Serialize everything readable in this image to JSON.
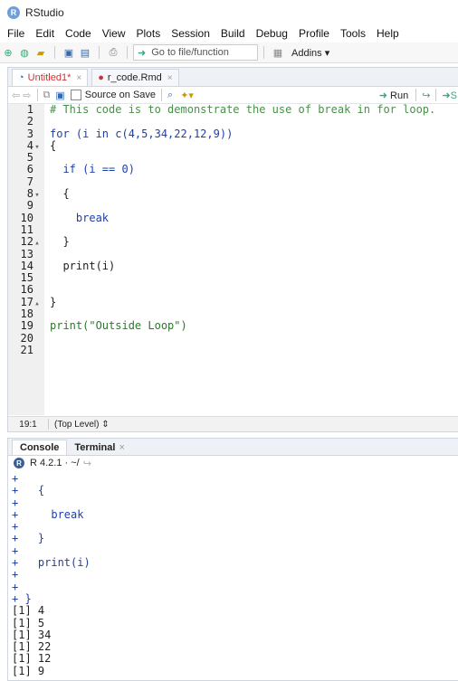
{
  "app": {
    "title": "RStudio",
    "logo": "R"
  },
  "menu": [
    "File",
    "Edit",
    "Code",
    "View",
    "Plots",
    "Session",
    "Build",
    "Debug",
    "Profile",
    "Tools",
    "Help"
  ],
  "toolbar": {
    "goto_placeholder": "Go to file/function",
    "addins_label": "Addins"
  },
  "editor": {
    "tabs": [
      {
        "label": "Untitled1*"
      },
      {
        "label": "r_code.Rmd"
      }
    ],
    "source_on_save": "Source on Save",
    "run_label": "Run",
    "status": {
      "position": "19:1",
      "scope": "(Top Level)"
    },
    "lines": [
      {
        "n": "1",
        "text": "# This code is to demonstrate the use of break in for loop.",
        "cls": "comment",
        "fold": ""
      },
      {
        "n": "2",
        "text": "",
        "cls": "",
        "fold": ""
      },
      {
        "n": "3",
        "text": "for (i in c(4,5,34,22,12,9))",
        "cls": "kw",
        "fold": ""
      },
      {
        "n": "4",
        "text": "{",
        "cls": "",
        "fold": "▾"
      },
      {
        "n": "5",
        "text": "",
        "cls": "",
        "fold": ""
      },
      {
        "n": "6",
        "text": "  if (i == 0)",
        "cls": "kw",
        "fold": ""
      },
      {
        "n": "7",
        "text": "",
        "cls": "",
        "fold": ""
      },
      {
        "n": "8",
        "text": "  {",
        "cls": "",
        "fold": "▾"
      },
      {
        "n": "9",
        "text": "",
        "cls": "",
        "fold": ""
      },
      {
        "n": "10",
        "text": "    break",
        "cls": "kw",
        "fold": ""
      },
      {
        "n": "11",
        "text": "",
        "cls": "",
        "fold": ""
      },
      {
        "n": "12",
        "text": "  }",
        "cls": "",
        "fold": "▴"
      },
      {
        "n": "13",
        "text": "",
        "cls": "",
        "fold": ""
      },
      {
        "n": "14",
        "text": "  print(i)",
        "cls": "",
        "fold": ""
      },
      {
        "n": "15",
        "text": "",
        "cls": "",
        "fold": ""
      },
      {
        "n": "16",
        "text": "",
        "cls": "",
        "fold": ""
      },
      {
        "n": "17",
        "text": "}",
        "cls": "",
        "fold": "▴"
      },
      {
        "n": "18",
        "text": "",
        "cls": "",
        "fold": ""
      },
      {
        "n": "19",
        "text": "print(\"Outside Loop\")",
        "cls": "str",
        "fold": ""
      },
      {
        "n": "20",
        "text": "",
        "cls": "",
        "fold": ""
      },
      {
        "n": "21",
        "text": "",
        "cls": "",
        "fold": ""
      }
    ]
  },
  "console": {
    "tabs": [
      {
        "label": "Console"
      },
      {
        "label": "Terminal"
      }
    ],
    "version": "R 4.2.1 · ~/",
    "lines": [
      {
        "text": "+",
        "cls": "plus"
      },
      {
        "text": "+   {",
        "cls": "plus"
      },
      {
        "text": "+",
        "cls": "plus"
      },
      {
        "text": "+     break",
        "cls": "plus"
      },
      {
        "text": "+",
        "cls": "plus"
      },
      {
        "text": "+   }",
        "cls": "plus"
      },
      {
        "text": "+",
        "cls": "plus"
      },
      {
        "text": "+   print(i)",
        "cls": "plus"
      },
      {
        "text": "+",
        "cls": "plus"
      },
      {
        "text": "+",
        "cls": "plus"
      },
      {
        "text": "+ }",
        "cls": "plus"
      },
      {
        "text": "[1] 4",
        "cls": ""
      },
      {
        "text": "[1] 5",
        "cls": ""
      },
      {
        "text": "[1] 34",
        "cls": ""
      },
      {
        "text": "[1] 22",
        "cls": ""
      },
      {
        "text": "[1] 12",
        "cls": ""
      },
      {
        "text": "[1] 9",
        "cls": ""
      }
    ]
  }
}
